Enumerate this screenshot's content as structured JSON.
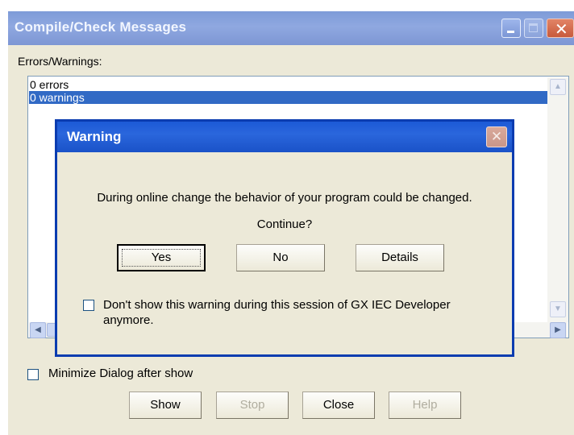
{
  "main_window": {
    "title": "Compile/Check Messages",
    "errors_label": "Errors/Warnings:",
    "messages": [
      "0 errors",
      "0 warnings"
    ],
    "selected_index": 1,
    "minimize_label": "Minimize  Dialog after show",
    "minimize_checked": false,
    "buttons": {
      "show": "Show",
      "stop": "Stop",
      "close": "Close",
      "help": "Help"
    },
    "disabled_buttons": [
      "Stop",
      "Help"
    ]
  },
  "warning_dialog": {
    "title": "Warning",
    "message": "During online change the behavior of your program could be changed.",
    "question": "Continue?",
    "buttons": {
      "yes": "Yes",
      "no": "No",
      "details": "Details"
    },
    "dont_show_label": "Don't show this warning during this session of GX IEC Developer anymore.",
    "dont_show_checked": false
  },
  "icons": {
    "minimize": "minimize-icon",
    "maximize": "maximize-icon",
    "close": "close-icon",
    "scroll_up": "chevron-up-icon",
    "scroll_down": "chevron-down-icon",
    "scroll_left": "chevron-left-icon",
    "scroll_right": "chevron-right-icon"
  },
  "colors": {
    "selection": "#316ac5",
    "dialog_title": "#1c5ad6",
    "inactive_title": "#8fa8e0",
    "face": "#ece9d8"
  }
}
